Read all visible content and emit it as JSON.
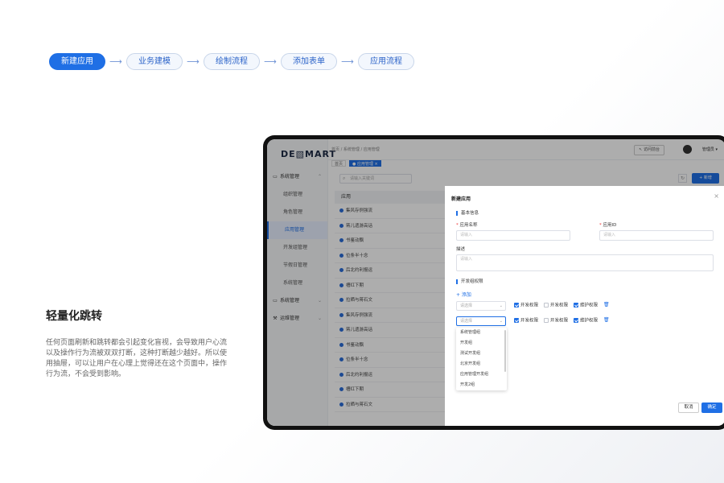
{
  "steps": [
    "新建应用",
    "业务建模",
    "绘制流程",
    "添加表单",
    "应用流程"
  ],
  "arrow": "⟶",
  "feature": {
    "title": "轻量化跳转",
    "desc": "任何页面刷新和跳转都会引起变化盲视，会导致用户心流以及操作行为流被双双打断，这种打断越少越好。所以使用抽屉，可以让用户在心理上觉得还在这个页面中，操作行为流，不会受到影响。"
  },
  "app": {
    "logo": "DE▧MART",
    "breadcrumb": "首页 / 系统管理 / 应用管理",
    "back_label": "↖ 访问前台",
    "user_label": "管理员 ▾",
    "tags": [
      "首页",
      "● 应用管理 ×"
    ],
    "nav": [
      {
        "label": "系统管理",
        "group": true,
        "icon": "▭",
        "chev": "⌃"
      },
      {
        "label": "组织管理"
      },
      {
        "label": "角色管理"
      },
      {
        "label": "应用管理",
        "active": true
      },
      {
        "label": "开发组管理"
      },
      {
        "label": "节假日管理"
      },
      {
        "label": "系统管理"
      },
      {
        "label": "系统管理",
        "group": true,
        "icon": "▭",
        "chev": "⌄"
      },
      {
        "label": "运维管理",
        "group": true,
        "icon": "⚒",
        "chev": "⌄"
      }
    ],
    "search_placeholder": "请输入关键词",
    "search_icon": "⌕",
    "refresh_icon": "↻",
    "new_button": "+ 新增",
    "table_header": "应用",
    "rows": [
      "集风存例强流",
      "蒋儿遗游高话",
      "书鉴动飘",
      "位条半十念",
      "后北约利报运",
      "槽红下期",
      "拉晒与蒋石文",
      "集风存例强流",
      "蒋儿遗游高话",
      "书鉴动飘",
      "位条半十念",
      "后北约利报运",
      "槽红下期",
      "拉晒与蒋石文"
    ]
  },
  "drawer": {
    "title": "新建应用",
    "close_icon": "×",
    "section_basic": "基本信息",
    "app_name_label": "应用名称",
    "app_name_placeholder": "请输入",
    "app_id_label": "应用ID",
    "app_id_placeholder": "请输入",
    "desc_label": "描述",
    "desc_placeholder": "请输入",
    "section_perm": "开发组权限",
    "add_label": "+ 添加",
    "select_placeholder": "请选择",
    "perm_rows": [
      {
        "perms": [
          {
            "label": "开发权限",
            "checked": true
          },
          {
            "label": "开发权限",
            "checked": false
          },
          {
            "label": "维护权限",
            "checked": true
          }
        ]
      },
      {
        "perms": [
          {
            "label": "开发权限",
            "checked": true
          },
          {
            "label": "开发权限",
            "checked": false
          },
          {
            "label": "维护权限",
            "checked": true
          }
        ]
      }
    ],
    "trash_icon": "🗑",
    "dropdown_options": [
      "系统管理组",
      "开发组",
      "测试开发组",
      "北京开发组",
      "应用管理开发组",
      "开发2组"
    ],
    "cancel_label": "取消",
    "ok_label": "确定"
  }
}
